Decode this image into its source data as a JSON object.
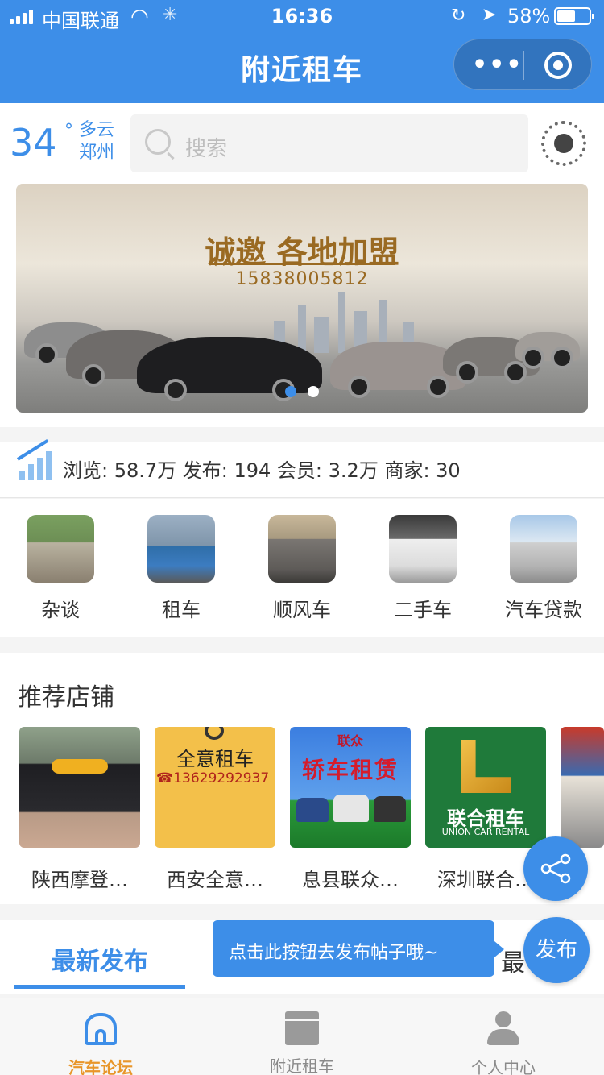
{
  "status_bar": {
    "carrier": "中国联通",
    "time": "16:36",
    "battery_pct": "58%",
    "battery_level": 0.58
  },
  "nav": {
    "title": "附近租车"
  },
  "weather": {
    "temp": "34",
    "degree": "°",
    "condition": "多云",
    "city": "郑州"
  },
  "search": {
    "placeholder": "搜索"
  },
  "banner": {
    "headline": "诚邀 各地加盟",
    "phone": "15838005812",
    "page_count": 2,
    "active_page": 1
  },
  "stats": {
    "text": "浏览: 58.7万  发布: 194  会员: 3.2万  商家: 30"
  },
  "categories": [
    {
      "label": "杂谈"
    },
    {
      "label": "租车"
    },
    {
      "label": "顺风车"
    },
    {
      "label": "二手车"
    },
    {
      "label": "汽车贷款"
    }
  ],
  "shops": {
    "header": "推荐店铺",
    "items": [
      {
        "name": "陕西摩登…"
      },
      {
        "name": "西安全意…",
        "img_title": "全意租车",
        "img_phone": "13629292937"
      },
      {
        "name": "息县联众…",
        "img_title": "轿车租赁",
        "img_top": "联众"
      },
      {
        "name": "深圳联合…",
        "img_title": "联合租车",
        "img_sub": "UNION CAR RENTAL"
      }
    ]
  },
  "tabs": {
    "latest": "最新发布",
    "other_partial": "最",
    "tooltip": "点击此按钮去发布帖子哦~",
    "publish": "发布"
  },
  "tabbar": {
    "items": [
      {
        "label": "汽车论坛"
      },
      {
        "label": "附近租车"
      },
      {
        "label": "个人中心"
      }
    ]
  },
  "colors": {
    "primary": "#3d8ee8",
    "active_tab_label": "#e8962a"
  }
}
